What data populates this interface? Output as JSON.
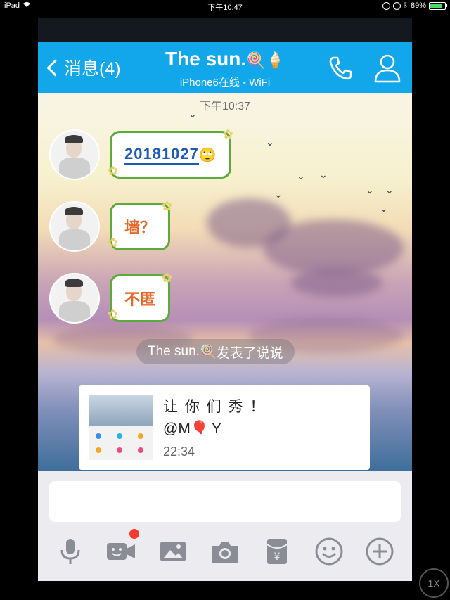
{
  "status_bar": {
    "device": "iPad",
    "time": "下午10:47",
    "battery": "89%"
  },
  "nav": {
    "back_label": "消息(4)",
    "title": "The sun.",
    "title_decoration": "🍭🍦",
    "subtitle": "iPhone6在线 - WiFi"
  },
  "chat": {
    "timestamp": "下午10:37",
    "messages": [
      {
        "text": "20181027",
        "emoji": "🙄"
      },
      {
        "text": "墙？"
      },
      {
        "text": "不匿"
      }
    ],
    "system_notice": {
      "name": "The sun.",
      "emoji": "🍭",
      "action": "发表了说说"
    },
    "card": {
      "title": "让 你 们 秀 ！",
      "mention_prefix": "@M",
      "mention_emoji": "🎈",
      "mention_suffix": "Y",
      "time": "22:34"
    }
  },
  "input": {
    "value": "",
    "placeholder": ""
  },
  "toolbar": {
    "items": [
      "microphone-icon",
      "video-call-icon",
      "image-icon",
      "camera-icon",
      "red-packet-icon",
      "emoji-icon",
      "plus-icon"
    ]
  },
  "overlay": {
    "replay_speed": "1X"
  },
  "colors": {
    "nav_blue": "#12a6ea",
    "bubble_border": "#5daa3a",
    "badge_red": "#f53b2e"
  }
}
